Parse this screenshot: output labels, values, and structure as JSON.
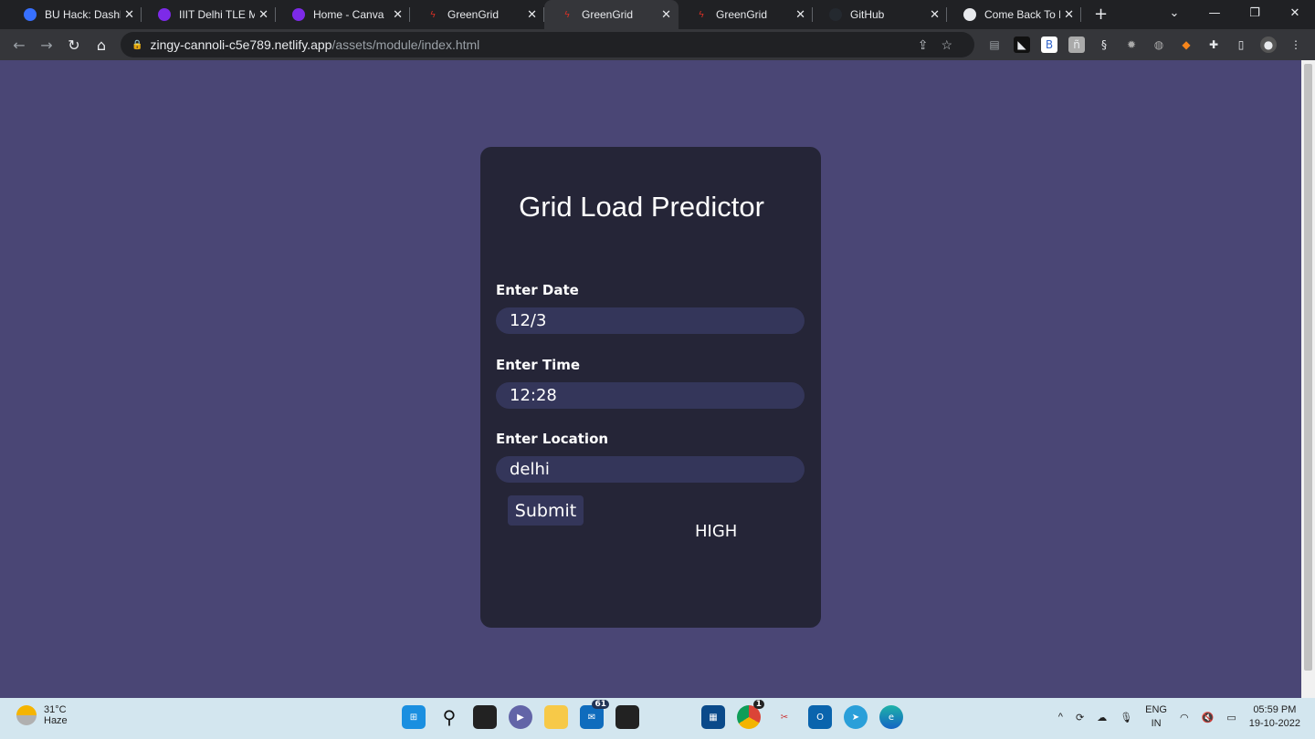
{
  "browser": {
    "tabs": [
      {
        "title": "BU Hack: Dashboard",
        "icon": "devfolio-icon",
        "color": "#3770ff"
      },
      {
        "title": "IIIT Delhi TLE Mas",
        "icon": "canva-icon",
        "color": "#7d2ae8"
      },
      {
        "title": "Home - Canva",
        "icon": "canva-icon",
        "color": "#7d2ae8"
      },
      {
        "title": "GreenGrid",
        "icon": "bolt-icon",
        "color": "#d93025"
      },
      {
        "title": "GreenGrid",
        "icon": "bolt-icon",
        "color": "#d93025",
        "active": true
      },
      {
        "title": "GreenGrid",
        "icon": "bolt-icon",
        "color": "#d93025"
      },
      {
        "title": "GitHub",
        "icon": "github-icon",
        "color": "#24292f"
      },
      {
        "title": "Come Back To Po",
        "icon": "globe-icon",
        "color": "#e8eaed"
      }
    ],
    "url_host": "zingy-cannoli-c5e789.netlify.app",
    "url_path": "/assets/module/index.html"
  },
  "app": {
    "title": "Grid Load Predictor",
    "fields": [
      {
        "label": "Enter Date",
        "value": "12/3"
      },
      {
        "label": "Enter Time",
        "value": "12:28"
      },
      {
        "label": "Enter Location",
        "value": "delhi"
      }
    ],
    "submit_label": "Submit",
    "result": "HIGH",
    "colors": {
      "page_bg": "#4a4675",
      "card_bg": "#252537",
      "input_bg": "#34365a"
    }
  },
  "taskbar": {
    "weather_temp": "31°C",
    "weather_desc": "Haze",
    "mail_badge": "61",
    "chrome_badge": "1",
    "lang": "ENG",
    "region": "IN",
    "time": "05:59 PM",
    "date": "19-10-2022"
  }
}
